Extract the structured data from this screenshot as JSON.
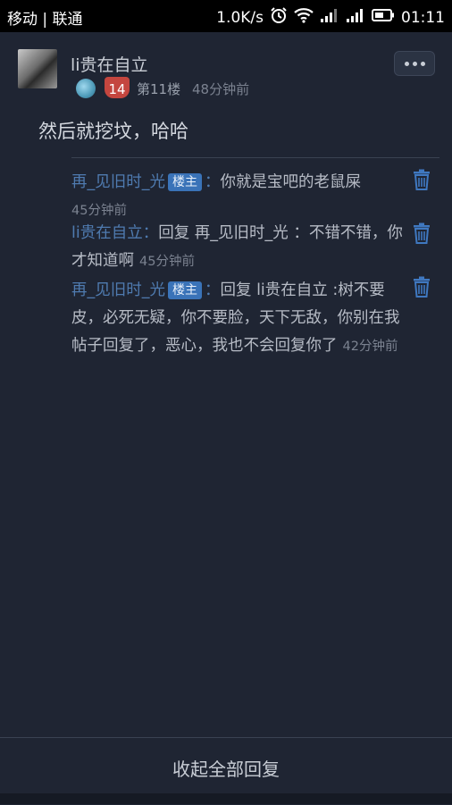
{
  "status_bar": {
    "carrier": "移动 | 联通",
    "speed": "1.0K/s",
    "time": "01:11",
    "icons": [
      "alarm-icon",
      "wifi-icon",
      "signal-icon",
      "signal-icon",
      "battery-icon"
    ]
  },
  "post": {
    "username": "li贵在自立",
    "level": "14",
    "floor": "第11楼",
    "time": "48分钟前",
    "content": "然后就挖坟，哈哈"
  },
  "replies": [
    {
      "name": "再_见旧时_光",
      "tag": "楼主",
      "sep": "：",
      "text": "你就是宝吧的老鼠屎",
      "time": "45分钟前"
    },
    {
      "name": "li贵在自立",
      "tag": "",
      "sep": "：",
      "text": "回复 再_见旧时_光 ：不错不错，你才知道啊",
      "time": "45分钟前"
    },
    {
      "name": "再_见旧时_光",
      "tag": "楼主",
      "sep": "：",
      "text": "回复 li贵在自立 :树不要皮，必死无疑，你不要脸，天下无敌，你别在我帖子回复了，恶心，我也不会回复你了",
      "time": "42分钟前"
    }
  ],
  "footer": {
    "collapse_label": "收起全部回复"
  },
  "colors": {
    "background": "#1f2533",
    "name_link": "#4f7bb0",
    "tag_bg": "#3a73b8"
  }
}
